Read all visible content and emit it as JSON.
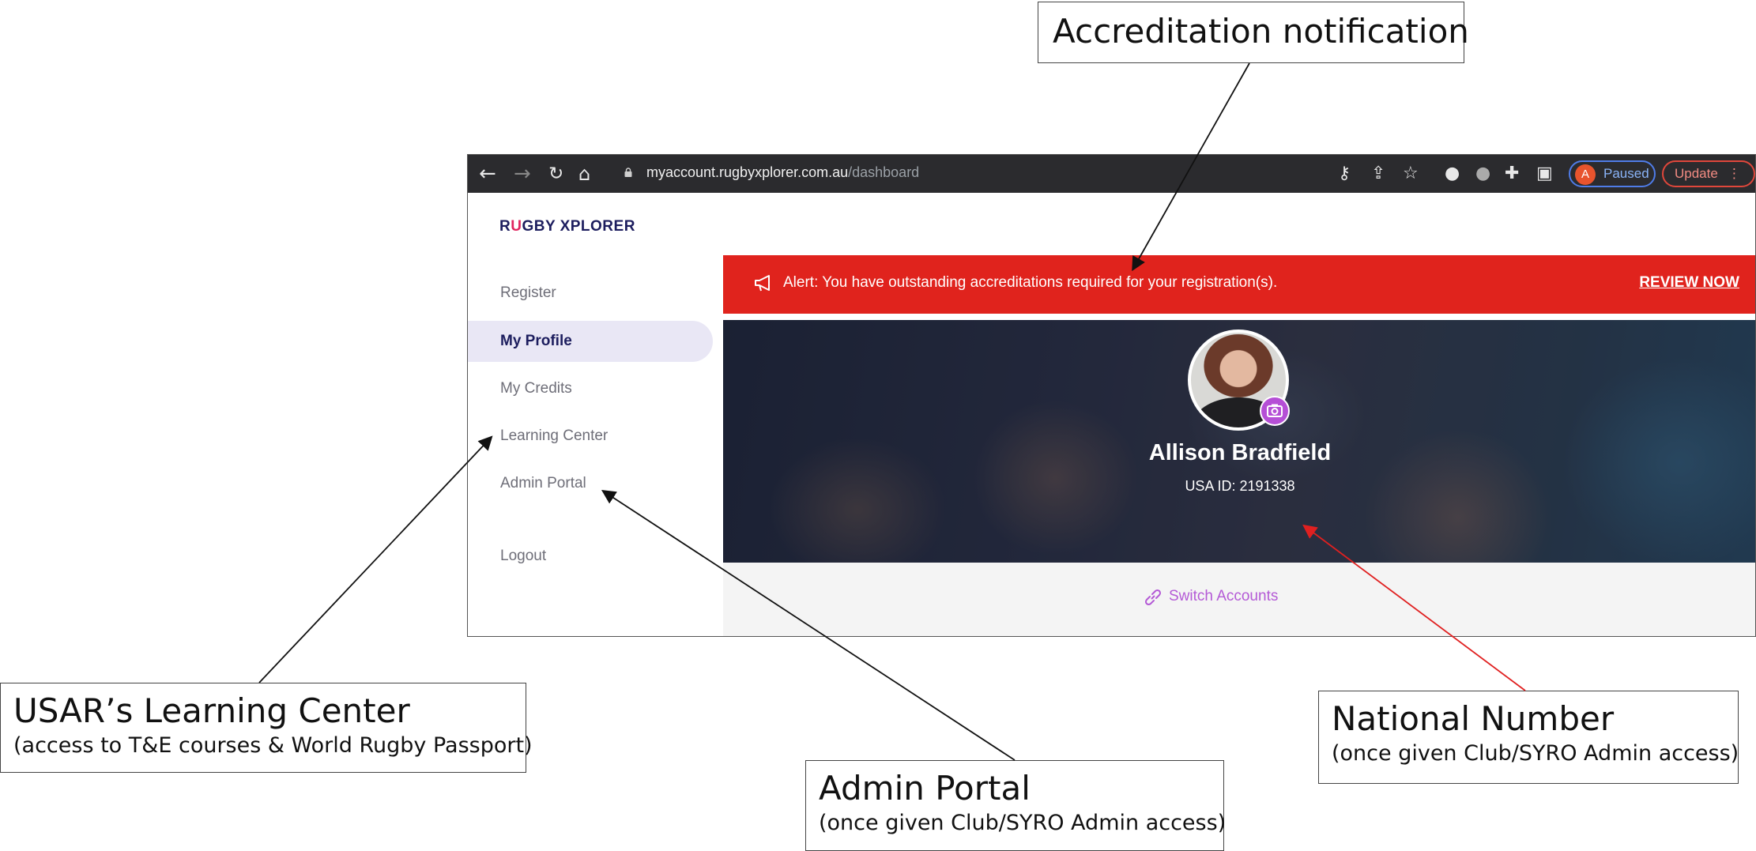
{
  "browser": {
    "url_host": "myaccount.rugbyxplorer.com.au",
    "url_path": "/dashboard",
    "profile_initial": "A",
    "profile_status": "Paused",
    "update_label": "Update"
  },
  "app": {
    "logo_r": "R",
    "logo_u": "U",
    "logo_rest": "GBY XPLORER",
    "nav": [
      {
        "label": "Register"
      },
      {
        "label": "My Profile",
        "active": true
      },
      {
        "label": "My Credits"
      },
      {
        "label": "Learning Center"
      },
      {
        "label": "Admin Portal"
      },
      {
        "label": "Logout"
      }
    ],
    "alert": {
      "message": "Alert: You have outstanding accreditations required for your registration(s).",
      "action": "REVIEW NOW",
      "color": "#e0231d"
    },
    "profile": {
      "name": "Allison Bradfield",
      "id_text": "USA ID: 2191338"
    },
    "switch_label": "Switch Accounts"
  },
  "annotations": {
    "accreditation": {
      "title": "Accreditation notification"
    },
    "learning_center": {
      "title": "USAR’s Learning Center",
      "subtitle": "(access to T&E courses & World Rugby Passport)"
    },
    "national_number": {
      "title": "National Number",
      "subtitle": "(once given Club/SYRO Admin access)"
    },
    "admin_portal": {
      "title": "Admin Portal",
      "subtitle": "(once given Club/SYRO Admin access)"
    }
  }
}
